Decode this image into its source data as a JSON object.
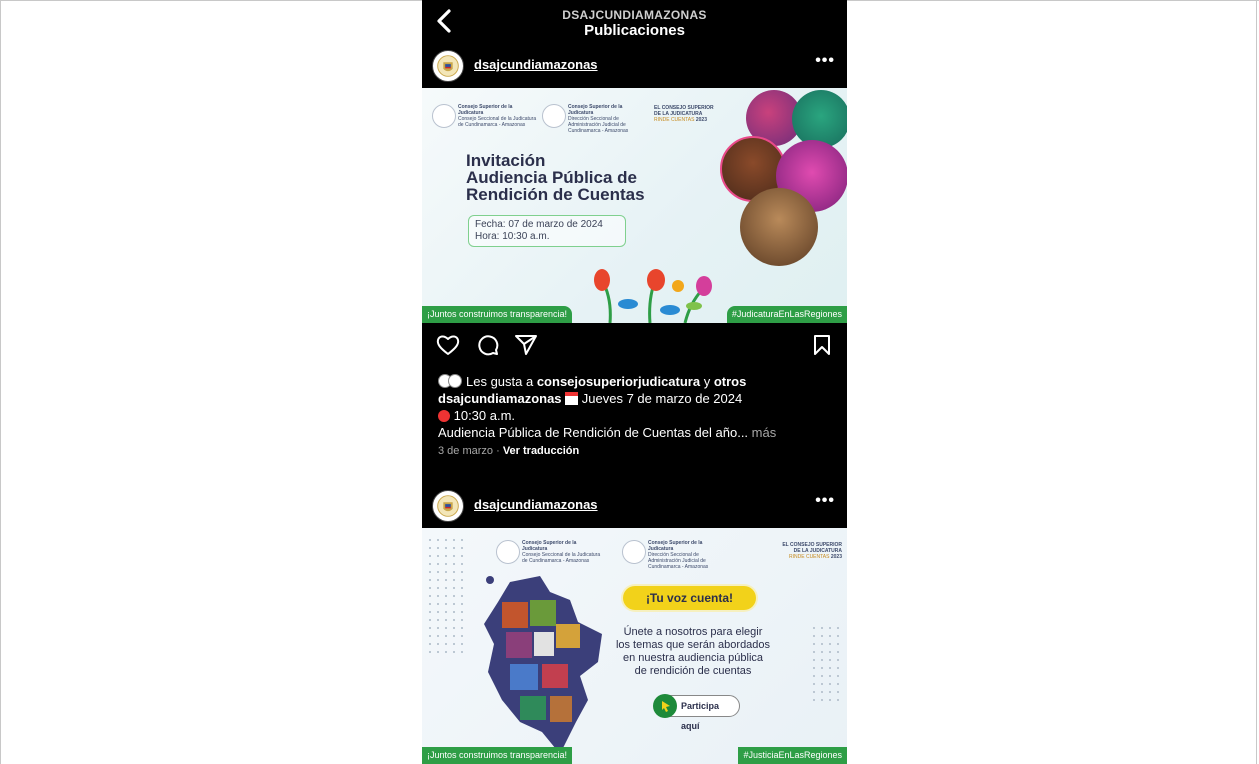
{
  "header": {
    "username": "DSAJCUNDIAMAZONAS",
    "title": "Publicaciones"
  },
  "posts": [
    {
      "username": "dsajcundiamazonas",
      "image": {
        "org1": "Consejo Superior de la Judicatura",
        "org1_sub": "Consejo Seccional de la Judicatura de Cundinamarca - Amazonas",
        "org2": "Consejo Superior de la Judicatura",
        "org2_sub": "Dirección Seccional de Administración Judicial de Cundinamarca - Amazonas",
        "rinde_line1": "EL CONSEJO SUPERIOR",
        "rinde_line2": "DE LA JUDICATURA",
        "rinde_line3": "RINDE CUENTAS",
        "rinde_year": "2023",
        "title_line1": "Invitación",
        "title_line2": "Audiencia Pública de",
        "title_line3": "Rendición de Cuentas",
        "date_line": "Fecha: 07 de marzo de 2024",
        "time_line": "Hora: 10:30 a.m.",
        "banner_left": "¡Juntos construimos transparencia!",
        "banner_right": "#JudicaturaEnLasRegiones"
      },
      "likes_prefix": "Les gusta a ",
      "likes_user": "consejosuperiorjudicatura",
      "likes_mid": " y ",
      "likes_others": "otros",
      "caption_user": "dsajcundiamazonas",
      "caption_date": " Jueves 7 de marzo de 2024",
      "caption_time": " 10:30 a.m.",
      "caption_text": "Audiencia Pública de Rendición de Cuentas del año...",
      "caption_more": " más",
      "timestamp": "3 de marzo",
      "translate": "Ver traducción"
    },
    {
      "username": "dsajcundiamazonas",
      "image": {
        "org1": "Consejo Superior de la Judicatura",
        "org1_sub": "Consejo Seccional de la Judicatura de Cundinamarca - Amazonas",
        "org2": "Consejo Superior de la Judicatura",
        "org2_sub": "Dirección Seccional de Administración Judicial de Cundinamarca - Amazonas",
        "rinde_line1": "EL CONSEJO SUPERIOR",
        "rinde_line2": "DE LA JUDICATURA",
        "rinde_line3": "RINDE CUENTAS",
        "rinde_year": "2023",
        "badge": "¡Tu voz cuenta!",
        "body_line1": "Únete a nosotros para elegir",
        "body_line2": "los temas que serán abordados",
        "body_line3": "en nuestra audiencia pública",
        "body_line4": "de rendición de cuentas",
        "cta": "Participa aquí",
        "banner_left": "¡Juntos construimos transparencia!",
        "banner_right": "#JusticiaEnLasRegiones"
      }
    }
  ],
  "colors": {
    "background": "#000000",
    "banner_green": "#2e9e46",
    "badge_yellow": "#f2d21a",
    "title_navy": "#2b2f4b"
  },
  "icons": [
    "back-chevron-icon",
    "more-dots-icon",
    "heart-icon",
    "comment-icon",
    "share-icon",
    "bookmark-icon",
    "calendar-emoji-icon",
    "alarm-clock-emoji-icon"
  ]
}
